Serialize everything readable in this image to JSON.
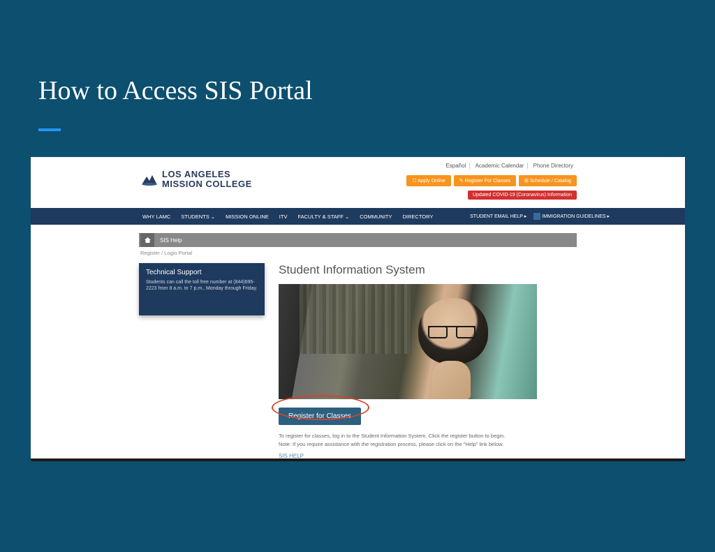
{
  "slide": {
    "title": "How to Access SIS Portal"
  },
  "header": {
    "logo_line1": "LOS ANGELES",
    "logo_line2": "MISSION COLLEGE",
    "top_links": {
      "espanol": "Español",
      "calendar": "Academic Calendar",
      "phone": "Phone Directory"
    },
    "buttons": {
      "apply": "☐ Apply Online",
      "register": "✎ Register For Classes",
      "schedule": "⊞ Schedule / Catalog"
    },
    "covid": "Updated COVID-19 (Coronavirus) Information"
  },
  "nav": {
    "why": "WHY LAMC",
    "students": "STUDENTS ⌄",
    "mission": "MISSION ONLINE",
    "itv": "ITV",
    "faculty": "FACULTY & STAFF ⌄",
    "community": "COMMUNITY",
    "directory": "DIRECTORY",
    "email": "STUDENT EMAIL HELP ▸",
    "immig": "IMMIGRATION GUIDELINES ▸"
  },
  "greybar": {
    "sis_help": "SIS Help"
  },
  "breadcrumb": {
    "text": "Register / Login Portal"
  },
  "tech": {
    "title": "Technical Support",
    "text": "Students can call the toll free number at (844)695-2223 from 8 a.m. to 7 p.m., Monday through Friday."
  },
  "main": {
    "title": "Student Information System",
    "register_btn": "Register for Classes",
    "instr1": "To register for classes, log in to the Student Information System. Click the register button to begin.",
    "instr2": "Note: If you require assistance with the registration process, please click on the \"Help\" link below.",
    "help_link": "SIS HELP"
  }
}
